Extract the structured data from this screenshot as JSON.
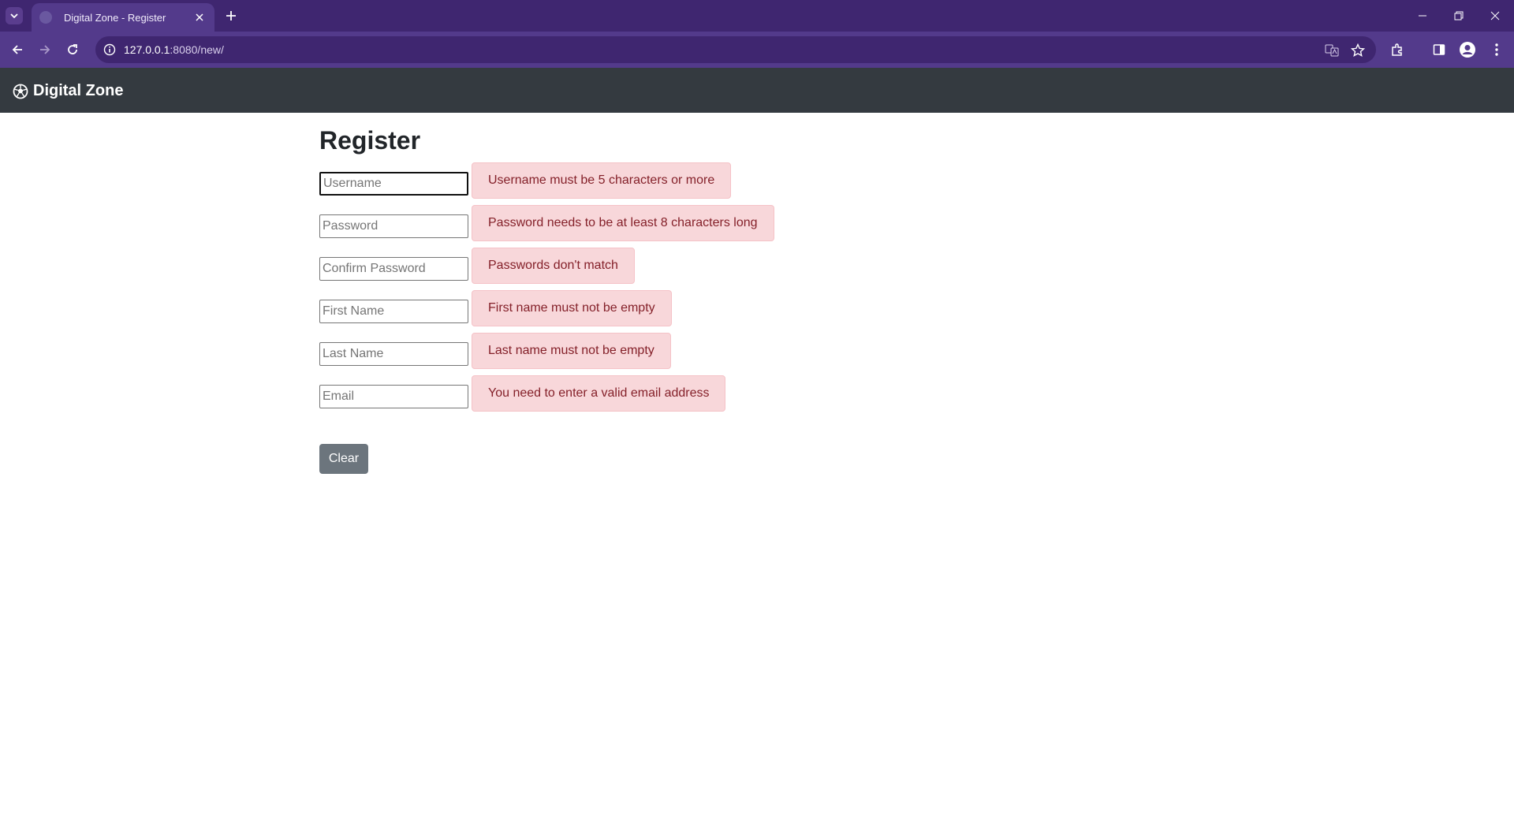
{
  "browser": {
    "tab_title": "Digital Zone - Register",
    "url_host": "127.0.0.1",
    "url_rest": ":8080/new/"
  },
  "navbar": {
    "brand": "Digital Zone",
    "brand_icon": "soccer-ball-icon"
  },
  "page": {
    "title": "Register",
    "fields": [
      {
        "placeholder": "Username",
        "value": "",
        "error": "Username must be 5 characters or more"
      },
      {
        "placeholder": "Password",
        "value": "",
        "error": "Password needs to be at least 8 characters long"
      },
      {
        "placeholder": "Confirm Password",
        "value": "",
        "error": "Passwords don't match"
      },
      {
        "placeholder": "First Name",
        "value": "",
        "error": "First name must not be empty"
      },
      {
        "placeholder": "Last Name",
        "value": "",
        "error": "Last name must not be empty"
      },
      {
        "placeholder": "Email",
        "value": "",
        "error": "You need to enter a valid email address"
      }
    ],
    "clear_label": "Clear"
  },
  "colors": {
    "browser_frame": "#3f2670",
    "browser_toolbar": "#533a8b",
    "navbar": "#343a40",
    "alert_bg": "#f8d7da",
    "alert_text": "#842029",
    "button_secondary": "#6c757d"
  }
}
